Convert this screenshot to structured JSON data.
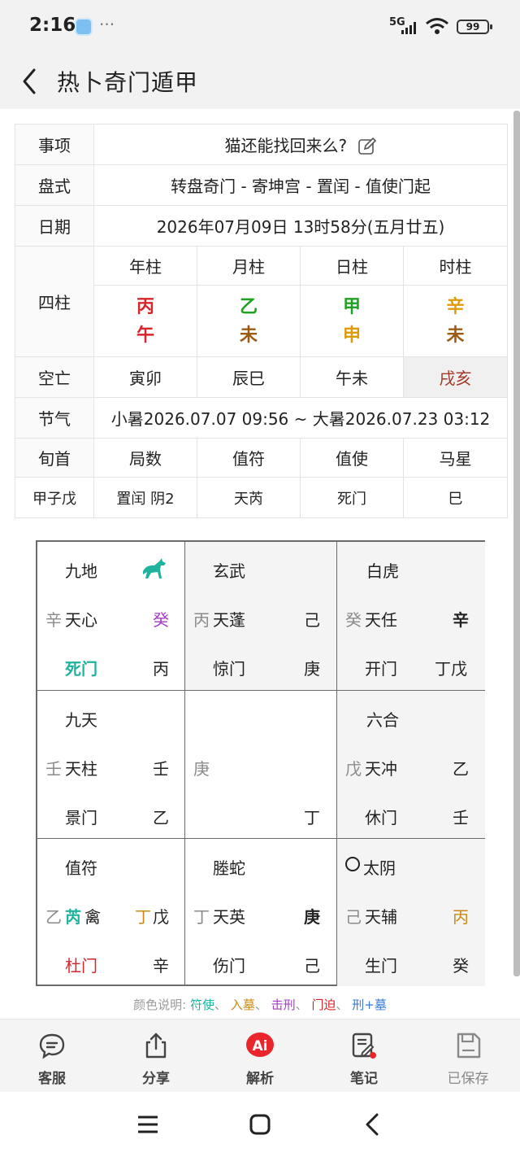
{
  "status": {
    "time": "2:16",
    "network": "5G",
    "battery": "99"
  },
  "header": {
    "title": "热卜奇门遁甲"
  },
  "info": {
    "matter_label": "事项",
    "matter": "猫还能找回来么?",
    "layout_label": "盘式",
    "layout": "转盘奇门 - 寄坤宫 - 置闰 - 值使门起",
    "date_label": "日期",
    "date": "2026年07月09日 13时58分(五月廿五)",
    "pillars_label": "四柱",
    "pillar_headers": [
      "年柱",
      "月柱",
      "日柱",
      "时柱"
    ],
    "pillar_stems": [
      "丙",
      "乙",
      "甲",
      "辛"
    ],
    "pillar_branches": [
      "午",
      "未",
      "申",
      "未"
    ],
    "void_label": "空亡",
    "voids": [
      "寅卯",
      "辰巳",
      "午未",
      "戌亥"
    ],
    "solar_label": "节气",
    "solar": "小暑2026.07.07 09:56 ~ 大暑2026.07.23 03:12",
    "bottom_headers": [
      "旬首",
      "局数",
      "值符",
      "值使",
      "马星"
    ],
    "bottom_values": [
      "甲子戊",
      "置闰 阴2",
      "天芮",
      "死门",
      "巳"
    ]
  },
  "board": {
    "cells": [
      {
        "god": "九地",
        "star_prefix": "辛",
        "star": "天心",
        "star_right": "癸",
        "door": "死门",
        "door_right": "丙"
      },
      {
        "god": "玄武",
        "star_prefix": "丙",
        "star": "天蓬",
        "star_right": "己",
        "door": "惊门",
        "door_right": "庚"
      },
      {
        "god": "白虎",
        "star_prefix": "癸",
        "star": "天任",
        "star_right": "辛",
        "door": "开门",
        "door_right": "丁戊"
      },
      {
        "god": "九天",
        "star_prefix": "壬",
        "star": "天柱",
        "star_right": "壬",
        "door": "景门",
        "door_right": "乙"
      },
      {
        "center_left": "庚",
        "center_right": "丁"
      },
      {
        "god": "六合",
        "star_prefix": "戊",
        "star": "天冲",
        "star_right": "乙",
        "door": "休门",
        "door_right": "壬"
      },
      {
        "god": "值符",
        "star_prefix": "乙",
        "star": "芮",
        "star_suffix": "禽",
        "star_right_a": "丁",
        "star_right_b": "戊",
        "door": "杜门",
        "door_right": "辛"
      },
      {
        "god": "塍蛇",
        "star_prefix": "丁",
        "star": "天英",
        "star_right": "庚",
        "door": "伤门",
        "door_right": "己"
      },
      {
        "god": "太阴",
        "star_prefix": "己",
        "star": "天辅",
        "star_right": "丙",
        "door": "生门",
        "door_right": "癸"
      }
    ]
  },
  "legend": {
    "prefix": "颜色说明:",
    "items": [
      "符使",
      "入墓",
      "击刑",
      "门迫",
      "刑+墓"
    ],
    "sep": "、",
    "colors": [
      "#1fb39e",
      "#c98a17",
      "#a53dc6",
      "#d6262b",
      "#3a78d8"
    ]
  },
  "bottom_nav": [
    "客服",
    "分享",
    "解析",
    "笔记",
    "已保存"
  ]
}
